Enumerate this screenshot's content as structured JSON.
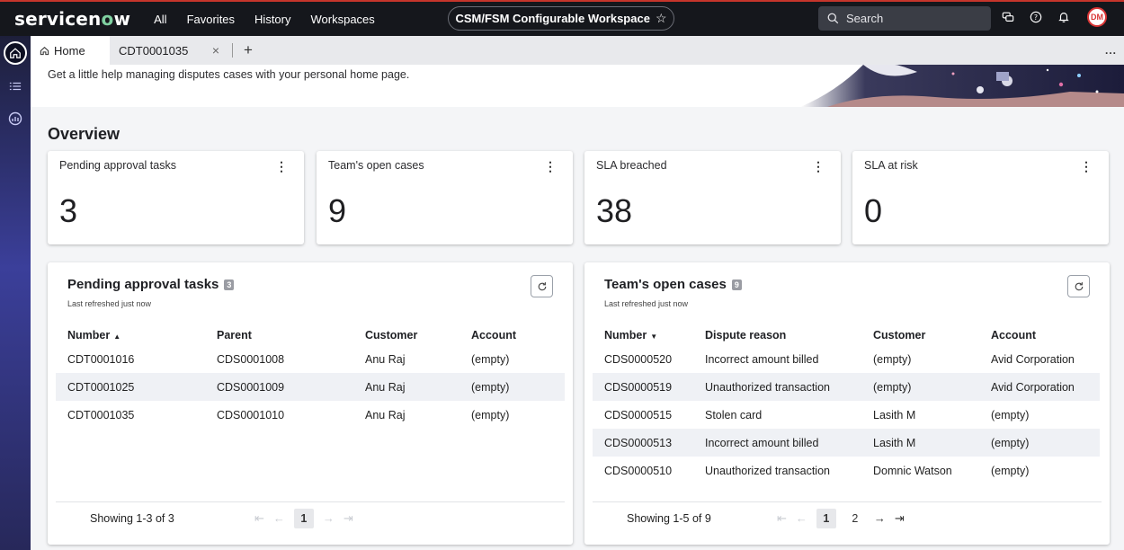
{
  "app": {
    "logo_left": "servicen",
    "logo_o": "o",
    "logo_right": "w",
    "nav": [
      "All",
      "Favorites",
      "History",
      "Workspaces"
    ],
    "workspace": "CSM/FSM Configurable Workspace",
    "search_placeholder": "Search",
    "avatar": "DM",
    "accent": "#c6352b"
  },
  "tabs": {
    "home": "Home",
    "record": "CDT0001035",
    "close": "×",
    "add": "+",
    "more": "..."
  },
  "page": {
    "help_text": "Get a little help managing disputes cases with your personal home page.",
    "overview": "Overview"
  },
  "kpis": [
    {
      "label": "Pending approval tasks",
      "value": "3"
    },
    {
      "label": "Team's open cases",
      "value": "9"
    },
    {
      "label": "SLA breached",
      "value": "38"
    },
    {
      "label": "SLA at risk",
      "value": "0"
    }
  ],
  "pending": {
    "title": "Pending approval tasks",
    "count": "3",
    "refreshed": "Last refreshed just now",
    "columns": [
      "Number",
      "Parent",
      "Customer",
      "Account"
    ],
    "sort_arrow": "▲",
    "rows": [
      [
        "CDT0001016",
        "CDS0001008",
        "Anu Raj",
        "(empty)"
      ],
      [
        "CDT0001025",
        "CDS0001009",
        "Anu Raj",
        "(empty)"
      ],
      [
        "CDT0001035",
        "CDS0001010",
        "Anu Raj",
        "(empty)"
      ]
    ],
    "showing": "Showing 1-3 of 3",
    "pages": [
      "1"
    ]
  },
  "team": {
    "title": "Team's open cases",
    "count": "9",
    "refreshed": "Last refreshed just now",
    "columns": [
      "Number",
      "Dispute reason",
      "Customer",
      "Account"
    ],
    "sort_arrow": "▼",
    "rows": [
      [
        "CDS0000520",
        "Incorrect amount billed",
        "(empty)",
        "Avid Corporation"
      ],
      [
        "CDS0000519",
        "Unauthorized transaction",
        "(empty)",
        "Avid Corporation"
      ],
      [
        "CDS0000515",
        "Stolen card",
        "Lasith M",
        "(empty)"
      ],
      [
        "CDS0000513",
        "Incorrect amount billed",
        "Lasith M",
        "(empty)"
      ],
      [
        "CDS0000510",
        "Unauthorized transaction",
        "Domnic Watson",
        "(empty)"
      ]
    ],
    "showing": "Showing 1-5 of 9",
    "pages": [
      "1",
      "2"
    ]
  }
}
